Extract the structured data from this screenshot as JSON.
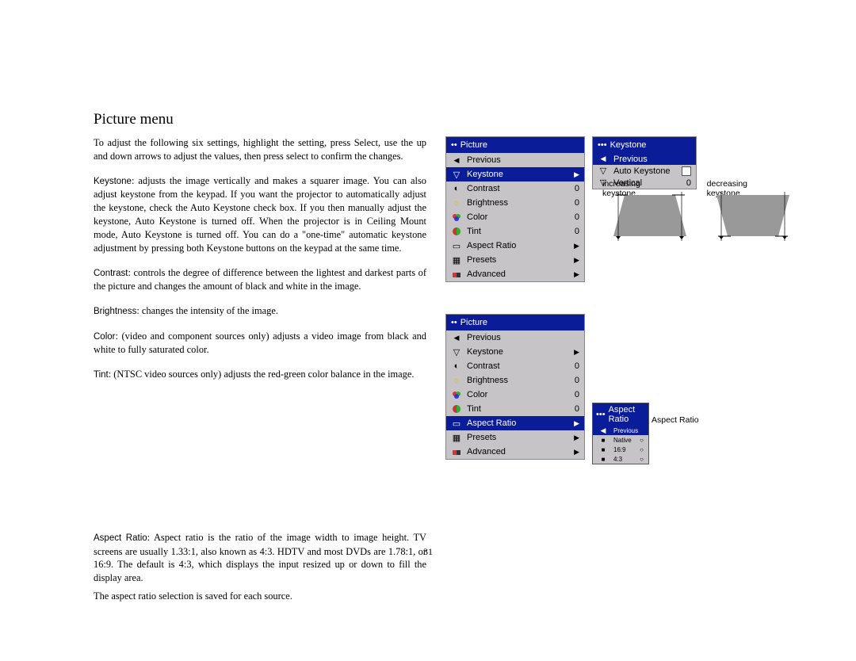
{
  "heading": "Picture menu",
  "p": {
    "intro": "To adjust the following six settings, highlight the setting, press Select, use the up and down arrows to adjust the values, then press select to confirm the changes.",
    "keystone": ": adjusts the image vertically and makes a squarer image. You can also adjust keystone from the keypad. If you want the projector to automat­ically adjust the keystone, check the Auto Keystone check box. If you then manually adjust the keystone, Auto Keystone is turned off. When the pro­jector is in Ceiling Mount mode, Auto Keystone is turned off. You can do a \"one-time\" automatic keystone adjustment by pressing both Keystone but­tons on the keypad at the same time.",
    "contrast": ": controls the degree of difference between the lightest and darkest parts of the picture and changes the amount of black and white in the image.",
    "brightness": ": changes the intensity of the image.",
    "color": ": (video and component sources only) adjusts a video image from black and white to fully saturated color.",
    "tint": ": (NTSC video sources only) adjusts the red-green color balance in the image.",
    "ar1": ": Aspect ratio is the ratio of the image width to image height. TV screens are usually 1.33:1, also known as 4:3. HDTV and most DVDs are 1.78:1, or 16:9. The default is 4:3, which displays the input resized up or down to fill the display area.",
    "ar2": "The aspect ratio selection is saved for each source."
  },
  "lbl": {
    "keystone": "Keystone",
    "contrast": "Contrast",
    "brightness": "Brightness",
    "color": "Color",
    "tint": "Tint",
    "aspectratio": "Aspect Ratio"
  },
  "menu1": {
    "title": "Picture",
    "items": [
      "Previous",
      "Keystone",
      "Contrast",
      "Brightness",
      "Color",
      "Tint",
      "Aspect Ratio",
      "Presets",
      "Advanced"
    ],
    "vals": [
      "",
      "",
      "0",
      "0",
      "0",
      "0",
      "",
      "",
      ""
    ]
  },
  "menu_ks": {
    "title": "Keystone",
    "items": [
      "Previous",
      "Auto Keystone",
      "Vertical"
    ],
    "vals": [
      "",
      "",
      "0"
    ]
  },
  "kslabels": {
    "inc": "increasing keystone",
    "dec": "decreasing keystone"
  },
  "menu2": {
    "title": "Picture",
    "items": [
      "Previous",
      "Keystone",
      "Contrast",
      "Brightness",
      "Color",
      "Tint",
      "Aspect Ratio",
      "Presets",
      "Advanced"
    ],
    "vals": [
      "",
      "",
      "0",
      "0",
      "0",
      "0",
      "",
      "",
      ""
    ]
  },
  "menu_ar": {
    "title": "Aspect Ratio",
    "items": [
      "Previous",
      "Native",
      "16:9",
      "4:3"
    ]
  },
  "arlabel": "Aspect Ratio",
  "pagenum": "31"
}
